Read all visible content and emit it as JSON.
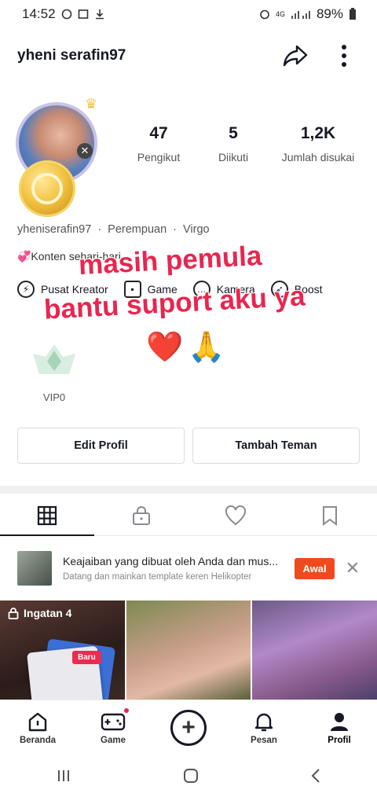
{
  "status_bar": {
    "time": "14:52",
    "signal_text": "4G",
    "battery": "89%"
  },
  "header": {
    "username": "yheni serafin97"
  },
  "profile": {
    "stats": [
      {
        "value": "47",
        "label": "Pengikut"
      },
      {
        "value": "5",
        "label": "Diikuti"
      },
      {
        "value": "1,2K",
        "label": "Jumlah disukai"
      }
    ],
    "handle": "yheniserafin97",
    "gender": "Perempuan",
    "zodiac": "Virgo",
    "bio": "💞Konten sehari-hari"
  },
  "shortcuts": [
    {
      "label": "Pusat Kreator"
    },
    {
      "label": "Game"
    },
    {
      "label": "Kamera"
    },
    {
      "label": "Boost"
    }
  ],
  "overlay": {
    "line1": "masih pemula",
    "line2": "bantu suport aku ya",
    "emojis": [
      "❤️",
      "🙏"
    ]
  },
  "vip": {
    "label": "VIP0"
  },
  "buttons": {
    "edit": "Edit Profil",
    "add_friend": "Tambah Teman"
  },
  "promo": {
    "title": "Keajaiban yang dibuat oleh Anda dan mus...",
    "subtitle": "Datang dan mainkan template keren Helikopter",
    "button": "Awal"
  },
  "grid": {
    "first_label": "Ingatan 4",
    "badge": "Baru"
  },
  "bottom_nav": [
    {
      "label": "Beranda"
    },
    {
      "label": "Game"
    },
    {
      "label": ""
    },
    {
      "label": "Pesan"
    },
    {
      "label": "Profil"
    }
  ],
  "colors": {
    "accent": "#e8264f",
    "promo_button": "#ee4a1d",
    "text": "#161823"
  }
}
